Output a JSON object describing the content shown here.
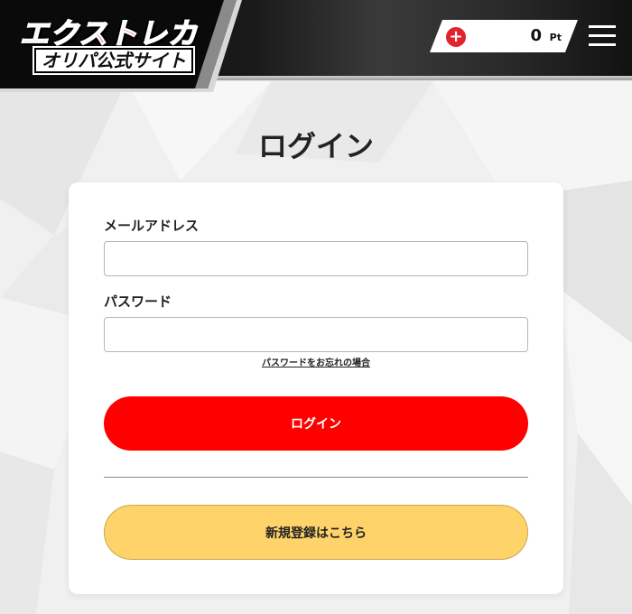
{
  "header": {
    "logo_main": "エクストレカ",
    "logo_sub": "オリパ公式サイト",
    "points": {
      "value": "0",
      "unit": "Pt"
    }
  },
  "page": {
    "title": "ログイン"
  },
  "form": {
    "email_label": "メールアドレス",
    "email_value": "",
    "password_label": "パスワード",
    "password_value": "",
    "forgot_password_link": "パスワードをお忘れの場合",
    "login_button": "ログイン",
    "register_button": "新規登録はこちら"
  },
  "colors": {
    "accent_red": "#ff0000",
    "register_yellow": "#fdd36a",
    "header_dark": "#1a1a1a"
  }
}
